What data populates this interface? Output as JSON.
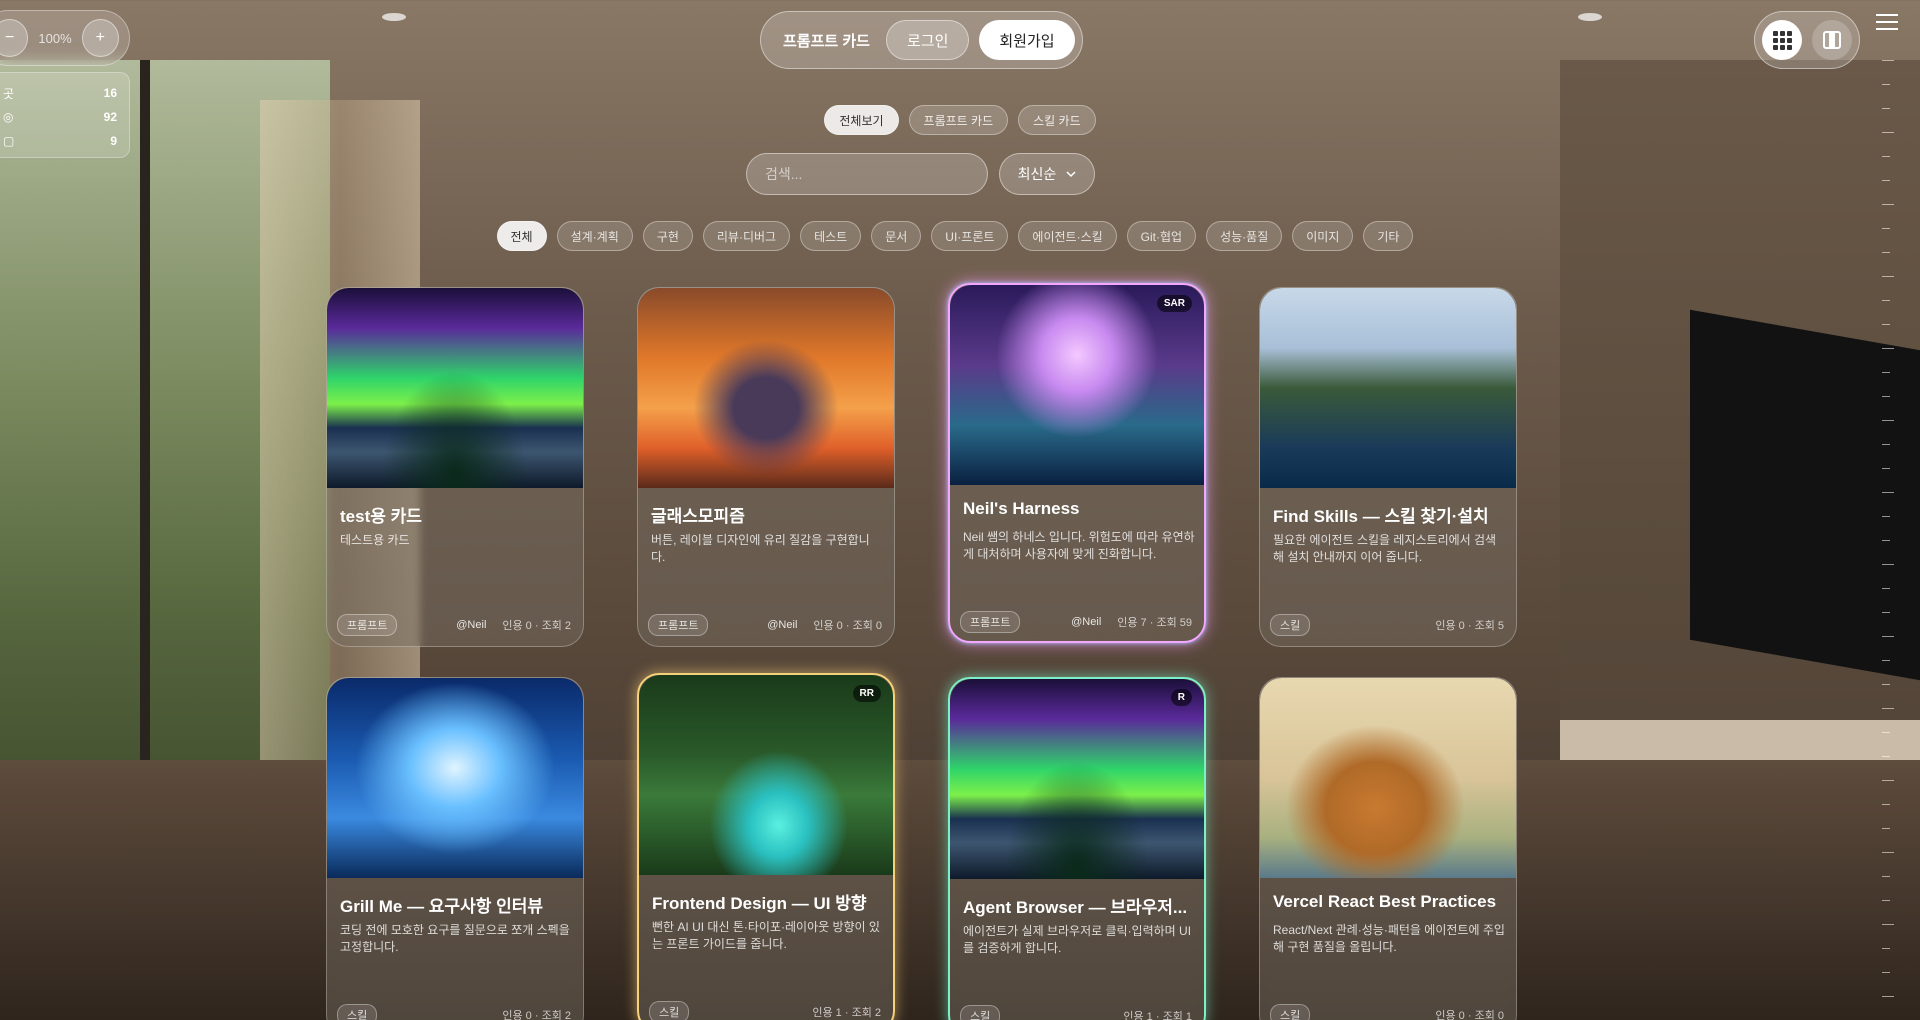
{
  "zoom": {
    "minus": "−",
    "value": "100%",
    "plus": "+"
  },
  "stats": [
    {
      "label": "곳",
      "value": "16"
    },
    {
      "label": "◎",
      "value": "92"
    },
    {
      "label": "▢",
      "value": "9"
    }
  ],
  "header": {
    "brand": "프롬프트 카드",
    "login": "로그인",
    "signup": "회원가입"
  },
  "view_tabs": [
    "전체보기",
    "프롬프트 카드",
    "스킬 카드"
  ],
  "search": {
    "placeholder": "검색..."
  },
  "sort": {
    "value": "최신순"
  },
  "categories": [
    "전체",
    "설계·계획",
    "구현",
    "리뷰·디버그",
    "테스트",
    "문서",
    "UI·프론트",
    "에이전트·스킬",
    "Git·협업",
    "성능·품질",
    "이미지",
    "기타"
  ],
  "cards": [
    {
      "title": "test용 카드",
      "desc": "테스트용 카드",
      "tag": "프롬프트",
      "author": "@Neil",
      "meta": "인용 0 · 조회 2",
      "badge": ""
    },
    {
      "title": "글래스모피즘",
      "desc": "버튼, 레이블 디자인에 유리 질감을 구현합니다.",
      "tag": "프롬프트",
      "author": "@Neil",
      "meta": "인용 0 · 조회 0",
      "badge": ""
    },
    {
      "title": "Neil's Harness",
      "desc": "Neil 쌤의 하네스 입니다. 위험도에 따라 유연하게 대처하며 사용자에 맞게 진화합니다.",
      "tag": "프롬프트",
      "author": "@Neil",
      "meta": "인용 7 · 조회 59",
      "badge": "SAR"
    },
    {
      "title": "Find Skills — 스킬 찾기·설치",
      "desc": "필요한 에이전트 스킬을 레지스트리에서 검색해 설치 안내까지 이어 줍니다.",
      "tag": "스킬",
      "author": "",
      "meta": "인용 0 · 조회 5",
      "badge": ""
    },
    {
      "title": "Grill Me — 요구사항 인터뷰",
      "desc": "코딩 전에 모호한 요구를 질문으로 쪼개 스펙을 고정합니다.",
      "tag": "스킬",
      "author": "",
      "meta": "인용 0 · 조회 2",
      "badge": ""
    },
    {
      "title": "Frontend Design — UI 방향",
      "desc": "뻔한 AI UI 대신 톤·타이포·레이아웃 방향이 있는 프론트 가이드를 줍니다.",
      "tag": "스킬",
      "author": "",
      "meta": "인용 1 · 조회 2",
      "badge": "RR"
    },
    {
      "title": "Agent Browser — 브라우저...",
      "desc": "에이전트가 실제 브라우저로 클릭·입력하며 UI를 검증하게 합니다.",
      "tag": "스킬",
      "author": "",
      "meta": "인용 1 · 조회 1",
      "badge": "R"
    },
    {
      "title": "Vercel React Best Practices",
      "desc": "React/Next 관례·성능·패턴을 에이전트에 주입해 구현 품질을 올립니다.",
      "tag": "스킬",
      "author": "",
      "meta": "인용 0 · 조회 0",
      "badge": ""
    }
  ],
  "icons": {
    "grid": "grid-view-icon",
    "single": "single-view-icon",
    "menu": "menu-icon"
  }
}
